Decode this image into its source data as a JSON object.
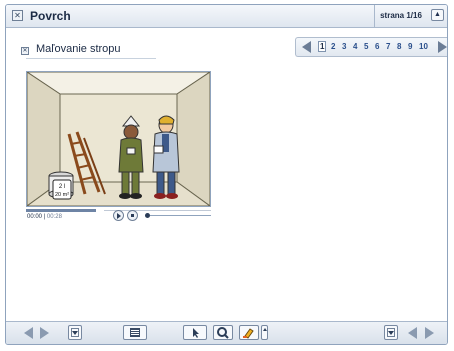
{
  "header": {
    "title": "Povrch",
    "page_indicator": "strana 1/16"
  },
  "lesson": {
    "subtitle": "Maľovanie stropu"
  },
  "pager": {
    "pages": [
      "1",
      "2",
      "3",
      "4",
      "5",
      "6",
      "7",
      "8",
      "9",
      "10"
    ],
    "current": "1"
  },
  "video": {
    "current_time": "00:00",
    "separator": "|",
    "duration": "00:28",
    "progress": 0.38,
    "sign_text_1": "2 l",
    "sign_text_2": "20 m²"
  },
  "colors": {
    "accent": "#2a4f8c",
    "border": "#8fa3bd",
    "bar_fill": "#6e84a5"
  }
}
